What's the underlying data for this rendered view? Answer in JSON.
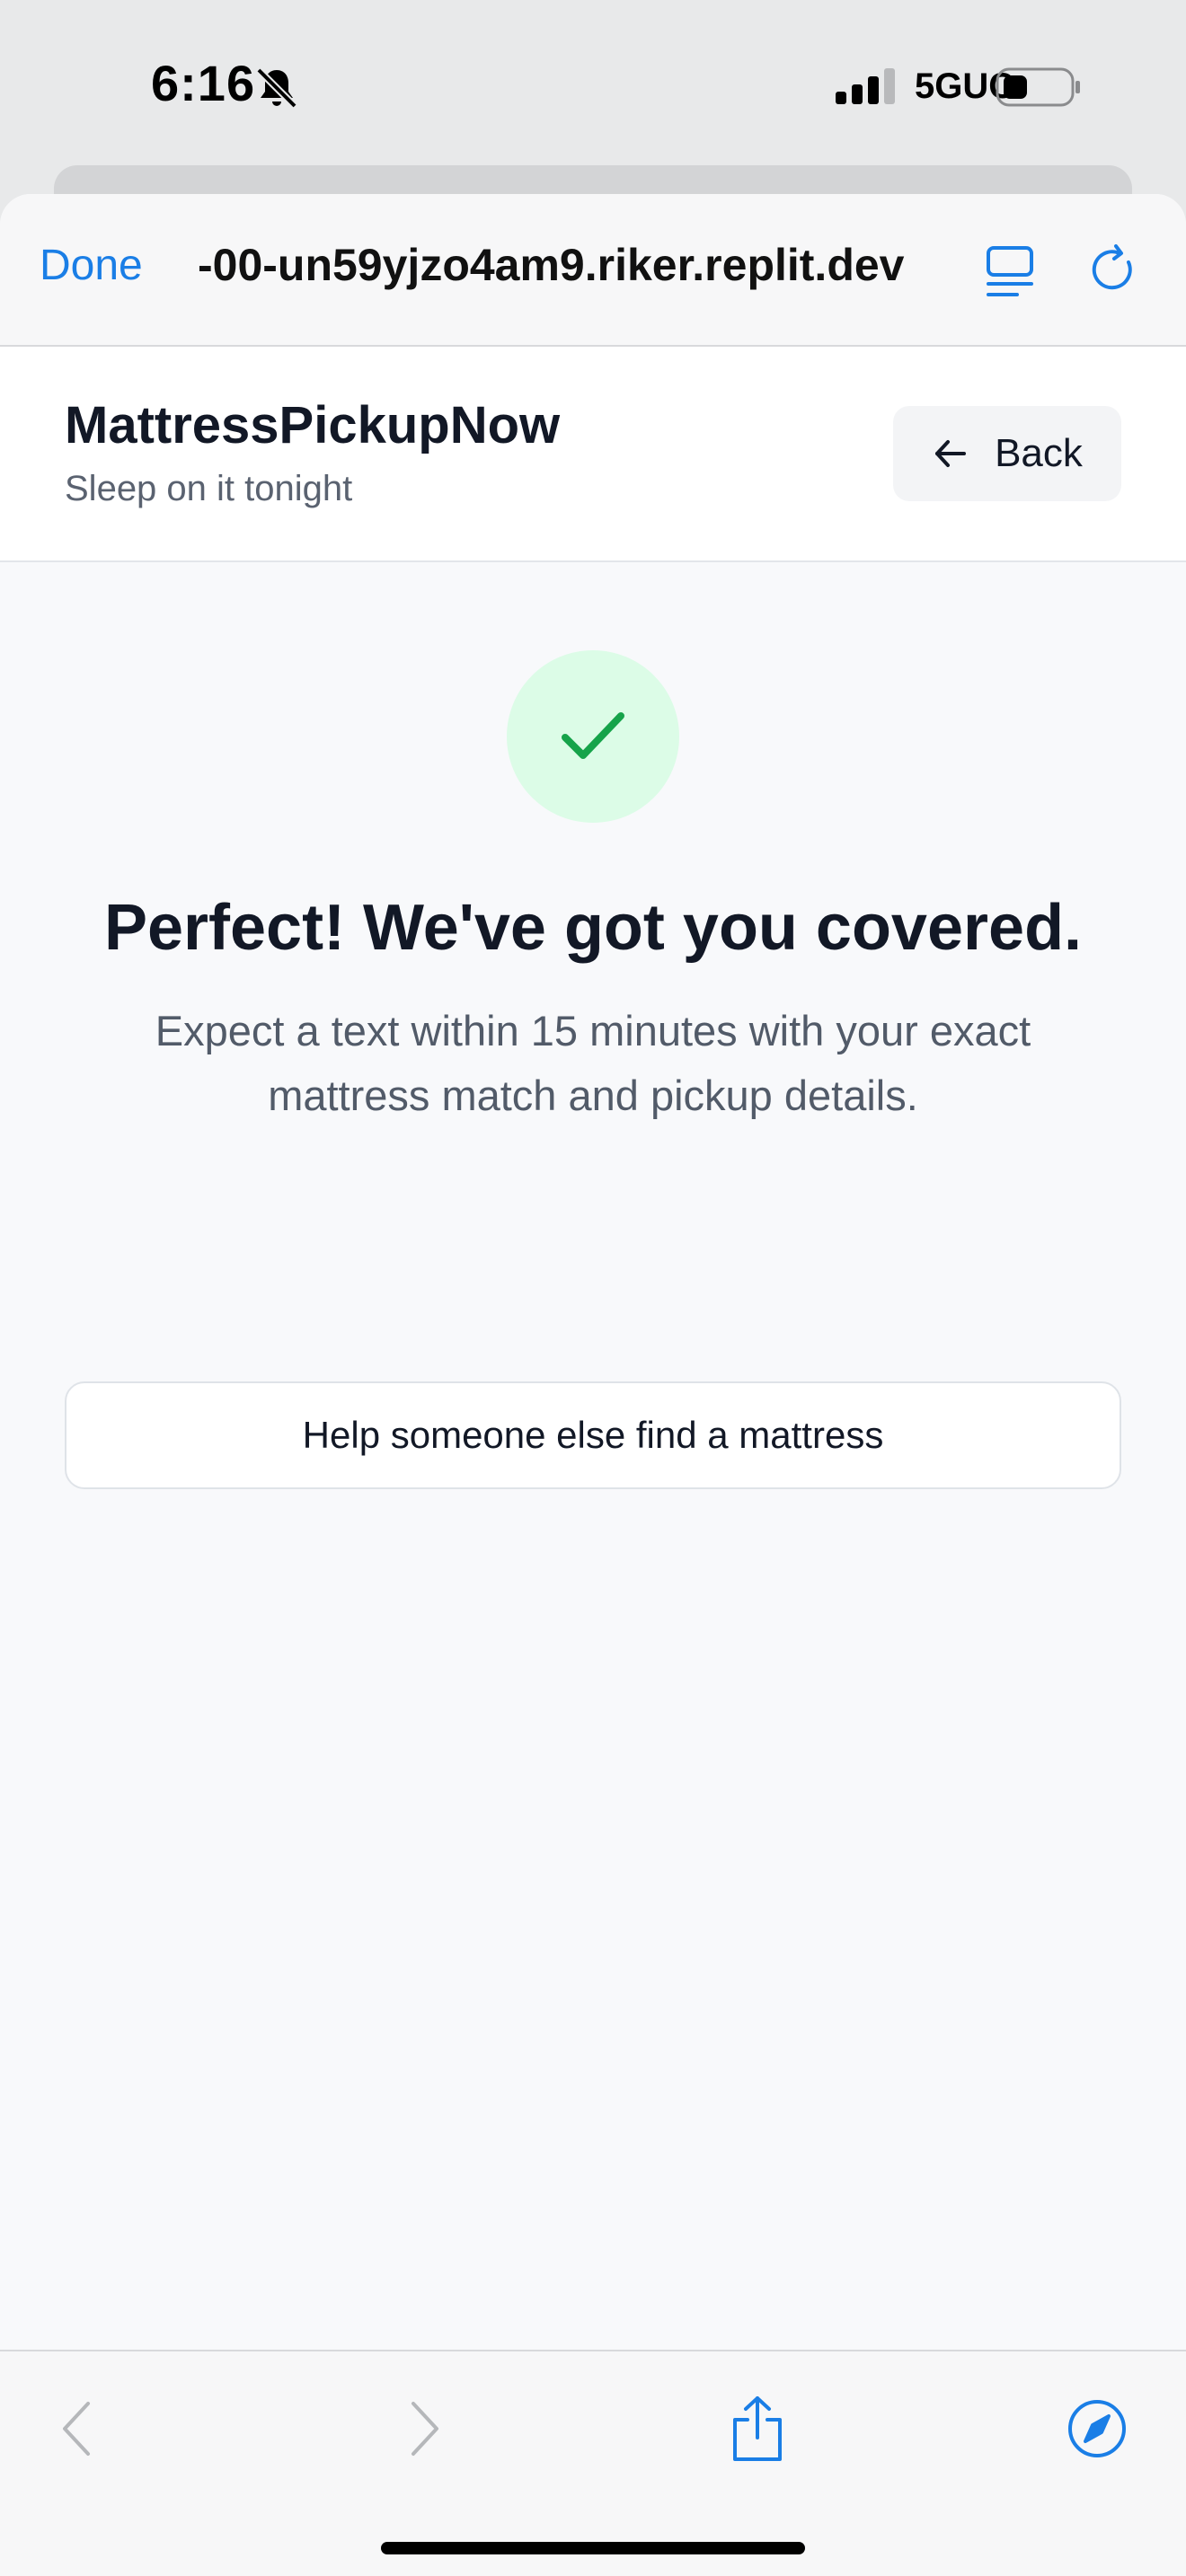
{
  "status_bar": {
    "time": "6:16",
    "network": "5GUC",
    "icons": [
      "bell-off-icon",
      "cell-signal-icon",
      "battery-icon"
    ]
  },
  "browser": {
    "done_label": "Done",
    "url": "-00-un59yjzo4am9.riker.replit.dev",
    "icons": [
      "reader-icon",
      "reload-icon"
    ],
    "accent_color": "#1a7ee6"
  },
  "header": {
    "brand": "MattressPickupNow",
    "tagline": "Sleep on it tonight",
    "back_label": "Back"
  },
  "confirmation": {
    "icon": "check-icon",
    "headline": "Perfect! We've got you covered.",
    "message": "Expect a text within 15 minutes with your exact mattress match and pickup details.",
    "cta_label": "Help someone else find a mattress",
    "success_color": "#16a34a"
  },
  "toolbar": {
    "icons": [
      "back-arrow-icon",
      "forward-arrow-icon",
      "share-icon",
      "compass-icon"
    ]
  }
}
